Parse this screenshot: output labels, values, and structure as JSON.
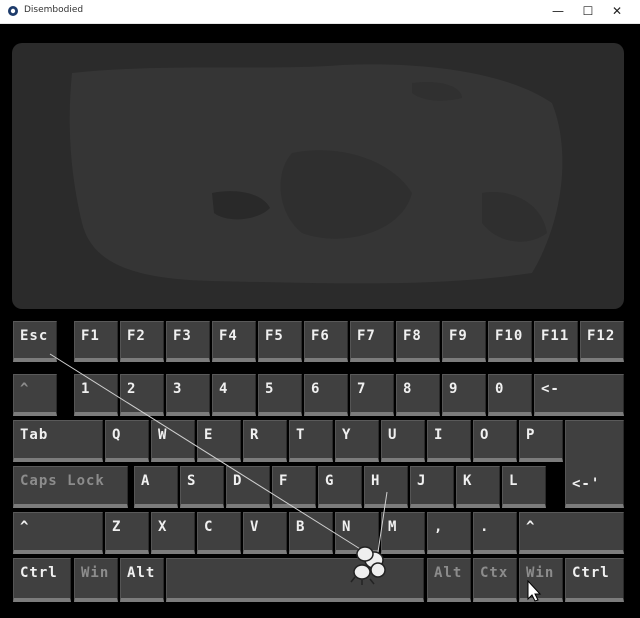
{
  "window": {
    "title": "Disembodied",
    "minimize": "—",
    "maximize": "☐",
    "close": "✕"
  },
  "keyboard": {
    "function_row": [
      "Esc",
      "F1",
      "F2",
      "F3",
      "F4",
      "F5",
      "F6",
      "F7",
      "F8",
      "F9",
      "F10",
      "F11",
      "F12"
    ],
    "number_row": [
      "^",
      "1",
      "2",
      "3",
      "4",
      "5",
      "6",
      "7",
      "8",
      "9",
      "0",
      "<-"
    ],
    "top_row": [
      "Tab",
      "Q",
      "W",
      "E",
      "R",
      "T",
      "Y",
      "U",
      "I",
      "O",
      "P"
    ],
    "home_row": [
      "Caps Lock",
      "A",
      "S",
      "D",
      "F",
      "G",
      "H",
      "J",
      "K",
      "L"
    ],
    "enter": "<-'",
    "bottom_row": [
      "^",
      "Z",
      "X",
      "C",
      "V",
      "B",
      "N",
      "M",
      ",",
      ".",
      "^"
    ],
    "modifier_row": [
      "Ctrl",
      "Win",
      "Alt",
      "",
      "Alt",
      "Ctx",
      "Win",
      "Ctrl"
    ]
  },
  "colors": {
    "background": "#000000",
    "screen": "#2b2b2b",
    "key_face": "#404040",
    "key_text": "#f0f0f0",
    "key_text_inactive": "#8c8c8c"
  }
}
